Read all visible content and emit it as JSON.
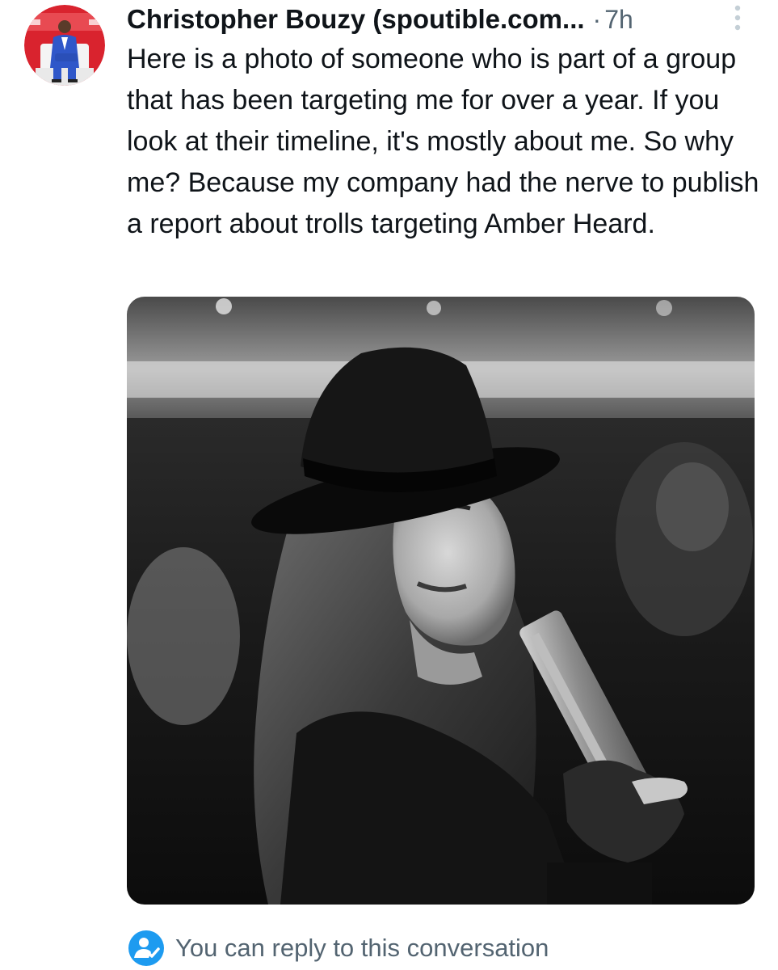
{
  "tweet": {
    "author": {
      "name": "Christopher Bouzy (spoutible.com...",
      "avatar_icon": "user-avatar-photo"
    },
    "separator": "·",
    "timestamp": "7h",
    "text": "Here is a photo of someone who is part of a group that has been targeting me for over a year. If you look at their timeline, it's mostly about me. So why me? Because my company had the nerve to publish a report about trolls targeting Amber Heard.",
    "media": {
      "type": "photo",
      "tone": "black-and-white"
    },
    "more_icon": "vertical-ellipsis-icon"
  },
  "reply_notice": {
    "icon": "person-check-icon",
    "text": "You can reply to this conversation"
  },
  "colors": {
    "text_primary": "#0f1419",
    "text_secondary": "#536471",
    "accent": "#1d9bf0",
    "avatar_background": "#d9232e"
  }
}
